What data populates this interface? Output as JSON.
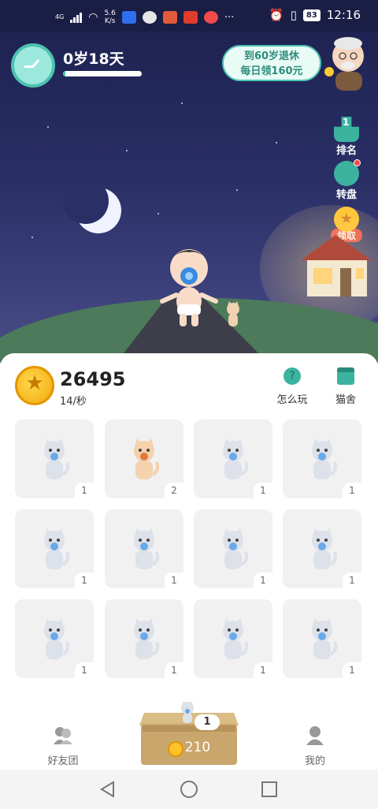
{
  "status_bar": {
    "network": "4G",
    "speed_value": "5.6",
    "speed_unit": "K/s",
    "battery": "83",
    "time": "12:16"
  },
  "header": {
    "age_text": "0岁18天",
    "age_progress": 0.03,
    "retire_line1": "到60岁退休",
    "retire_line2": "每日领160元"
  },
  "side_buttons": {
    "rank_badge": "1",
    "rank_label": "排名",
    "wheel_label": "转盘",
    "claim_label": "领取"
  },
  "wallet": {
    "coins": "26495",
    "rate": "14/秒",
    "how_to_play": "怎么玩",
    "cat_house": "猫舍"
  },
  "grid": {
    "cells": [
      {
        "level": "1",
        "variant": "gray"
      },
      {
        "level": "2",
        "variant": "orange"
      },
      {
        "level": "1",
        "variant": "gray"
      },
      {
        "level": "1",
        "variant": "gray"
      },
      {
        "level": "1",
        "variant": "gray"
      },
      {
        "level": "1",
        "variant": "gray"
      },
      {
        "level": "1",
        "variant": "gray"
      },
      {
        "level": "1",
        "variant": "gray"
      },
      {
        "level": "1",
        "variant": "gray"
      },
      {
        "level": "1",
        "variant": "gray"
      },
      {
        "level": "1",
        "variant": "gray"
      },
      {
        "level": "1",
        "variant": "gray"
      }
    ]
  },
  "bottom_nav": {
    "friends_label": "好友团",
    "mine_label": "我的",
    "box_level": "1",
    "box_price": "210"
  },
  "colors": {
    "sky": "#1e2352",
    "teal": "#4cc2b0",
    "coin": "#f2a90c",
    "panel": "#ffffff"
  }
}
